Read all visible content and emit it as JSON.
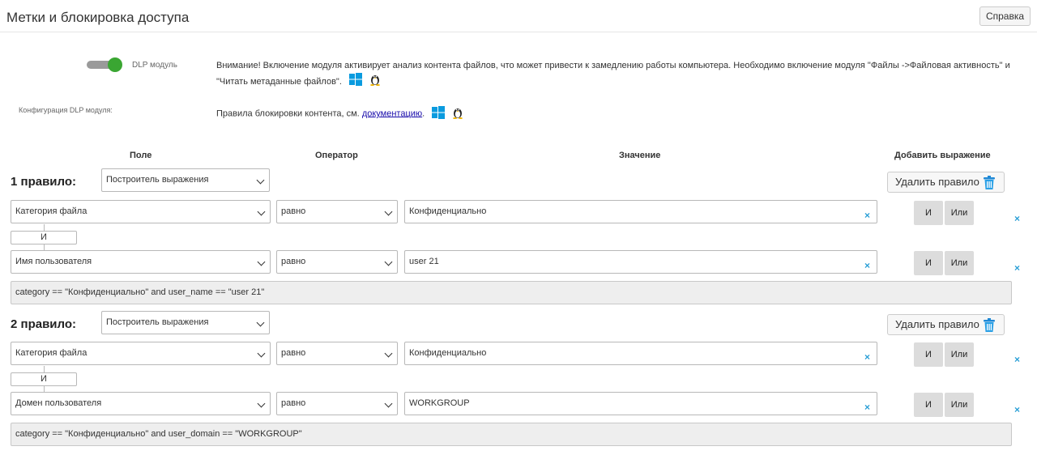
{
  "header": {
    "title": "Метки и блокировка доступа",
    "help_label": "Справка"
  },
  "dlp": {
    "toggle_label": "DLP модуль",
    "enabled": true,
    "warning": "Внимание! Включение модуля активирует анализ контента файлов, что может привести к замедлению работы компьютера. Необходимо включение модуля \"Файлы ->Файловая активность\" и \"Читать метаданные файлов\".",
    "config_label": "Конфигурация DLP модуля:",
    "config_text": "Правила блокировки контента, см.",
    "config_link": "документацию",
    "config_suffix": ".",
    "colors": {
      "toggle_on": "#3aa632",
      "windows": "#0a9bdf",
      "link": "#1a0dab",
      "clear_x": "#2a9fd6"
    }
  },
  "columns": {
    "field": "Поле",
    "operator": "Оператор",
    "value": "Значение",
    "add": "Добавить выражение"
  },
  "rules": [
    {
      "title": "1 правило:",
      "builder": "Построитель выражения",
      "delete_label": "Удалить правило",
      "conditions": [
        {
          "field": "Категория файла",
          "operator": "равно",
          "value": "Конфиденциально",
          "and": "И",
          "or": "Или"
        },
        {
          "field": "Имя пользователя",
          "operator": "равно",
          "value": "user 21",
          "and": "И",
          "or": "Или"
        }
      ],
      "connector": "И",
      "expression": "category == \"Конфиденциально\" and user_name == \"user 21\""
    },
    {
      "title": "2 правило:",
      "builder": "Построитель выражения",
      "delete_label": "Удалить правило",
      "conditions": [
        {
          "field": "Категория файла",
          "operator": "равно",
          "value": "Конфиденциально",
          "and": "И",
          "or": "Или"
        },
        {
          "field": "Домен пользователя",
          "operator": "равно",
          "value": "WORKGROUP",
          "and": "И",
          "or": "Или"
        }
      ],
      "connector": "И",
      "expression": "category == \"Конфиденциально\" and user_domain == \"WORKGROUP\""
    }
  ],
  "icons": {
    "clear": "×",
    "remove_row": "×",
    "trash": "trash-icon",
    "windows": "windows-icon",
    "linux": "linux-icon"
  }
}
